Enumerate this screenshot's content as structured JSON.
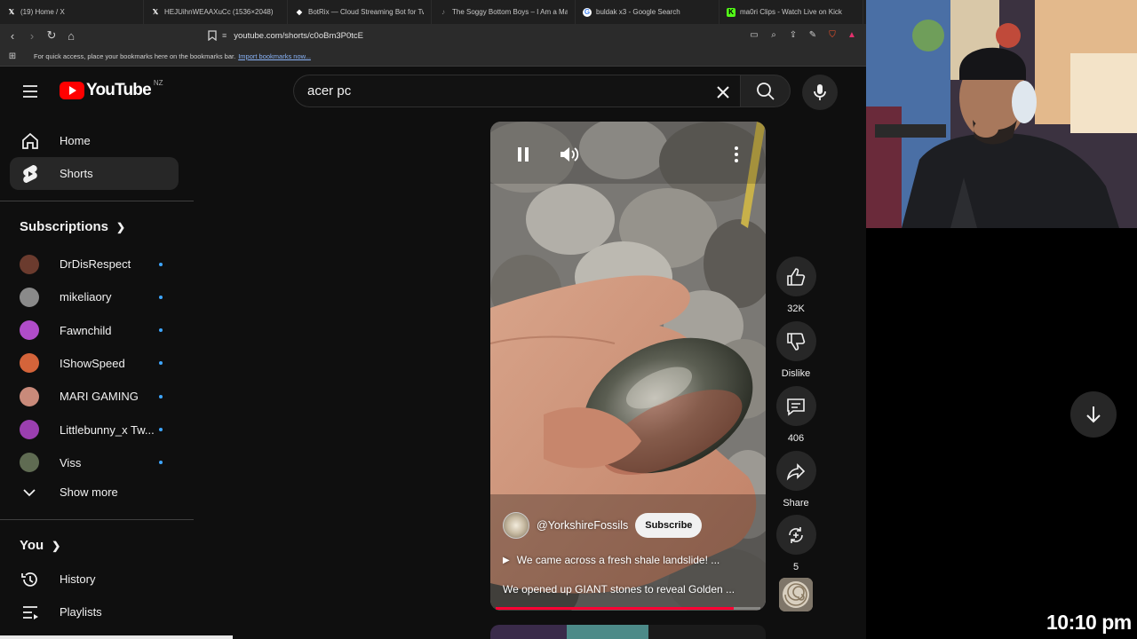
{
  "browser": {
    "tabs": [
      {
        "title": "(19) Home / X",
        "icon": "x-logo-icon"
      },
      {
        "title": "HEJUihnWEAAXuCc (1536×2048)",
        "icon": "x-logo-icon"
      },
      {
        "title": "BotRix — Cloud Streaming Bot for Tw",
        "icon": "botrix-icon"
      },
      {
        "title": "The Soggy Bottom Boys – I Am a Ma",
        "icon": "music-icon"
      },
      {
        "title": "buldak x3 - Google Search",
        "icon": "google-icon"
      },
      {
        "title": "ma0ri Clips - Watch Live on Kick",
        "icon": "kick-icon"
      }
    ],
    "url": "youtube.com/shorts/c0oBm3P0tcE",
    "bookmarks_text": "For quick access, place your bookmarks here on the bookmarks bar.",
    "bookmarks_link": "Import bookmarks now..."
  },
  "header": {
    "logo_text": "YouTube",
    "region": "NZ",
    "search_value": "acer pc"
  },
  "sidebar": {
    "home": "Home",
    "shorts": "Shorts",
    "subscriptions_title": "Subscriptions",
    "subscriptions": [
      {
        "name": "DrDisRespect",
        "color": "#6b3b2e"
      },
      {
        "name": "mikeliaory",
        "color": "#8a8a8a"
      },
      {
        "name": "Fawnchild",
        "color": "#b04cc9"
      },
      {
        "name": "IShowSpeed",
        "color": "#d4643a"
      },
      {
        "name": "MARI GAMING",
        "color": "#c98a7a"
      },
      {
        "name": "Littlebunny_x Tw...",
        "color": "#9b3fb0"
      },
      {
        "name": "Viss",
        "color": "#5f6b52"
      }
    ],
    "show_more": "Show more",
    "you_title": "You",
    "history": "History",
    "playlists": "Playlists"
  },
  "short": {
    "channel": "@YorkshireFossils",
    "subscribe": "Subscribe",
    "linked_video": "We came across a fresh shale landslide! ...",
    "title": "We opened up GIANT stones to reveal Golden ...",
    "progress": 0.9
  },
  "actions": {
    "likes": "32K",
    "dislike": "Dislike",
    "comments": "406",
    "share": "Share",
    "remix": "5"
  },
  "overlay": {
    "clock": "10:10 pm"
  }
}
